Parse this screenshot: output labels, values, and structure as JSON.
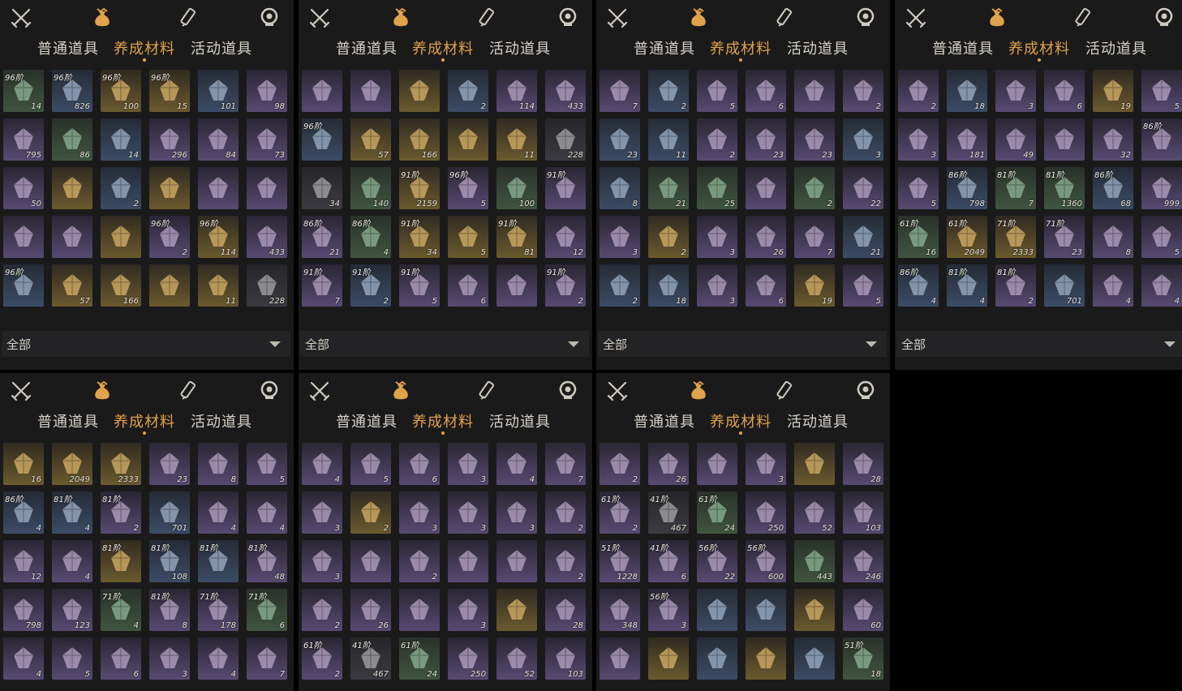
{
  "icons": [
    "crossed-swords-icon",
    "money-bag-icon",
    "scroll-icon",
    "gear-token-icon"
  ],
  "tabs": [
    "普通道具",
    "养成材料",
    "活动道具"
  ],
  "active_tab": "养成材料",
  "filter_label": "全部",
  "colors": {
    "accent": "#e0a24a",
    "tab_text": "#d6d2c9",
    "panel_bg": "#1b1a1b"
  },
  "panels": [
    {
      "id": "p1",
      "items": [
        [
          "96阶",
          "14",
          "green"
        ],
        [
          "96阶",
          "826",
          "blue"
        ],
        [
          "96阶",
          "100",
          "gold"
        ],
        [
          "96阶",
          "15",
          "gold"
        ],
        [
          "",
          "101",
          "blue"
        ],
        [
          "",
          "98",
          "purple"
        ],
        [
          "",
          "795",
          "purple"
        ],
        [
          "",
          "86",
          "green"
        ],
        [
          "",
          "14",
          "blue"
        ],
        [
          "",
          "296",
          "purple"
        ],
        [
          "",
          "84",
          "purple"
        ],
        [
          "",
          "73",
          "purple"
        ],
        [
          "",
          "50",
          "purple"
        ],
        [
          "",
          "",
          "gold"
        ],
        [
          "",
          "2",
          "blue"
        ],
        [
          "",
          "",
          "gold"
        ],
        [
          "",
          "",
          "purple"
        ],
        [
          "",
          "",
          "purple"
        ],
        [
          "",
          "",
          "purple"
        ],
        [
          "",
          "",
          "purple"
        ],
        [
          "",
          "",
          "gold"
        ],
        [
          "96阶",
          "2",
          "purple"
        ],
        [
          "96阶",
          "114",
          "gold"
        ],
        [
          "",
          "433",
          "purple"
        ],
        [
          "96阶",
          "",
          "blue"
        ],
        [
          "",
          "57",
          "gold"
        ],
        [
          "",
          "166",
          "gold"
        ],
        [
          "",
          "",
          "gold"
        ],
        [
          "",
          "11",
          "gold"
        ],
        [
          "",
          "228",
          "grey"
        ]
      ]
    },
    {
      "id": "p2",
      "items": [
        [
          "",
          "",
          "purple"
        ],
        [
          "",
          "",
          "purple"
        ],
        [
          "",
          "",
          "gold"
        ],
        [
          "",
          "2",
          "blue"
        ],
        [
          "",
          "114",
          "purple"
        ],
        [
          "",
          "433",
          "purple"
        ],
        [
          "96阶",
          "",
          "blue"
        ],
        [
          "",
          "57",
          "gold"
        ],
        [
          "",
          "166",
          "gold"
        ],
        [
          "",
          "",
          "gold"
        ],
        [
          "",
          "11",
          "gold"
        ],
        [
          "",
          "228",
          "grey"
        ],
        [
          "",
          "34",
          "grey"
        ],
        [
          "",
          "140",
          "green"
        ],
        [
          "91阶",
          "2159",
          "gold"
        ],
        [
          "96阶",
          "5",
          "purple"
        ],
        [
          "",
          "100",
          "green"
        ],
        [
          "91阶",
          "",
          "purple"
        ],
        [
          "86阶",
          "21",
          "purple"
        ],
        [
          "86阶",
          "4",
          "green"
        ],
        [
          "91阶",
          "34",
          "gold"
        ],
        [
          "",
          "5",
          "gold"
        ],
        [
          "91阶",
          "81",
          "gold"
        ],
        [
          "",
          "12",
          "purple"
        ],
        [
          "91阶",
          "7",
          "purple"
        ],
        [
          "91阶",
          "2",
          "blue"
        ],
        [
          "91阶",
          "5",
          "purple"
        ],
        [
          "",
          "6",
          "purple"
        ],
        [
          "",
          "",
          "purple"
        ],
        [
          "91阶",
          "2",
          "purple"
        ]
      ]
    },
    {
      "id": "p3",
      "items": [
        [
          "",
          "7",
          "purple"
        ],
        [
          "",
          "2",
          "blue"
        ],
        [
          "",
          "5",
          "purple"
        ],
        [
          "",
          "6",
          "purple"
        ],
        [
          "",
          "",
          "purple"
        ],
        [
          "",
          "2",
          "purple"
        ],
        [
          "",
          "23",
          "blue"
        ],
        [
          "",
          "11",
          "blue"
        ],
        [
          "",
          "2",
          "purple"
        ],
        [
          "",
          "23",
          "purple"
        ],
        [
          "",
          "23",
          "purple"
        ],
        [
          "",
          "3",
          "blue"
        ],
        [
          "",
          "8",
          "blue"
        ],
        [
          "",
          "21",
          "green"
        ],
        [
          "",
          "25",
          "green"
        ],
        [
          "",
          "",
          "purple"
        ],
        [
          "",
          "2",
          "green"
        ],
        [
          "",
          "22",
          "purple"
        ],
        [
          "",
          "3",
          "purple"
        ],
        [
          "",
          "2",
          "gold"
        ],
        [
          "",
          "3",
          "purple"
        ],
        [
          "",
          "26",
          "purple"
        ],
        [
          "",
          "7",
          "purple"
        ],
        [
          "",
          "21",
          "blue"
        ],
        [
          "",
          "2",
          "blue"
        ],
        [
          "",
          "18",
          "blue"
        ],
        [
          "",
          "3",
          "purple"
        ],
        [
          "",
          "6",
          "purple"
        ],
        [
          "",
          "19",
          "gold"
        ],
        [
          "",
          "5",
          "purple"
        ]
      ]
    },
    {
      "id": "p4",
      "items": [
        [
          "",
          "2",
          "purple"
        ],
        [
          "",
          "18",
          "blue"
        ],
        [
          "",
          "3",
          "purple"
        ],
        [
          "",
          "6",
          "purple"
        ],
        [
          "",
          "19",
          "gold"
        ],
        [
          "",
          "5",
          "purple"
        ],
        [
          "",
          "3",
          "purple"
        ],
        [
          "",
          "181",
          "purple"
        ],
        [
          "",
          "49",
          "purple"
        ],
        [
          "",
          "",
          "purple"
        ],
        [
          "",
          "32",
          "purple"
        ],
        [
          "86阶",
          "",
          "purple"
        ],
        [
          "",
          "5",
          "purple"
        ],
        [
          "86阶",
          "798",
          "blue"
        ],
        [
          "81阶",
          "7",
          "green"
        ],
        [
          "81阶",
          "1360",
          "green"
        ],
        [
          "86阶",
          "68",
          "blue"
        ],
        [
          "",
          "999",
          "purple"
        ],
        [
          "61阶",
          "16",
          "green"
        ],
        [
          "61阶",
          "2049",
          "gold"
        ],
        [
          "71阶",
          "2333",
          "gold"
        ],
        [
          "71阶",
          "23",
          "purple"
        ],
        [
          "",
          "8",
          "purple"
        ],
        [
          "",
          "5",
          "purple"
        ],
        [
          "86阶",
          "4",
          "blue"
        ],
        [
          "81阶",
          "4",
          "blue"
        ],
        [
          "81阶",
          "2",
          "purple"
        ],
        [
          "",
          "701",
          "blue"
        ],
        [
          "",
          "4",
          "purple"
        ],
        [
          "",
          "4",
          "purple"
        ]
      ]
    },
    {
      "id": "p5",
      "items": [
        [
          "",
          "16",
          "gold"
        ],
        [
          "",
          "2049",
          "gold"
        ],
        [
          "",
          "2333",
          "gold"
        ],
        [
          "",
          "23",
          "purple"
        ],
        [
          "",
          "8",
          "purple"
        ],
        [
          "",
          "5",
          "purple"
        ],
        [
          "86阶",
          "4",
          "blue"
        ],
        [
          "81阶",
          "4",
          "blue"
        ],
        [
          "81阶",
          "2",
          "purple"
        ],
        [
          "",
          "701",
          "blue"
        ],
        [
          "",
          "4",
          "purple"
        ],
        [
          "",
          "4",
          "purple"
        ],
        [
          "",
          "12",
          "purple"
        ],
        [
          "",
          "4",
          "purple"
        ],
        [
          "81阶",
          "",
          "gold"
        ],
        [
          "81阶",
          "108",
          "blue"
        ],
        [
          "81阶",
          "",
          "blue"
        ],
        [
          "81阶",
          "48",
          "purple"
        ],
        [
          "",
          "798",
          "purple"
        ],
        [
          "",
          "123",
          "purple"
        ],
        [
          "71阶",
          "4",
          "green"
        ],
        [
          "81阶",
          "8",
          "purple"
        ],
        [
          "71阶",
          "178",
          "purple"
        ],
        [
          "71阶",
          "6",
          "green"
        ],
        [
          "",
          "4",
          "purple"
        ],
        [
          "",
          "5",
          "purple"
        ],
        [
          "",
          "6",
          "purple"
        ],
        [
          "",
          "3",
          "purple"
        ],
        [
          "",
          "4",
          "purple"
        ],
        [
          "",
          "7",
          "purple"
        ]
      ]
    },
    {
      "id": "p6",
      "items": [
        [
          "",
          "4",
          "purple"
        ],
        [
          "",
          "5",
          "purple"
        ],
        [
          "",
          "6",
          "purple"
        ],
        [
          "",
          "3",
          "purple"
        ],
        [
          "",
          "4",
          "purple"
        ],
        [
          "",
          "7",
          "purple"
        ],
        [
          "",
          "3",
          "purple"
        ],
        [
          "",
          "2",
          "gold"
        ],
        [
          "",
          "3",
          "purple"
        ],
        [
          "",
          "3",
          "purple"
        ],
        [
          "",
          "3",
          "purple"
        ],
        [
          "",
          "2",
          "purple"
        ],
        [
          "",
          "3",
          "purple"
        ],
        [
          "",
          "",
          "purple"
        ],
        [
          "",
          "2",
          "purple"
        ],
        [
          "",
          "",
          "purple"
        ],
        [
          "",
          "",
          "purple"
        ],
        [
          "",
          "2",
          "purple"
        ],
        [
          "",
          "2",
          "purple"
        ],
        [
          "",
          "26",
          "purple"
        ],
        [
          "",
          "",
          "purple"
        ],
        [
          "",
          "3",
          "purple"
        ],
        [
          "",
          "",
          "gold"
        ],
        [
          "",
          "28",
          "purple"
        ],
        [
          "61阶",
          "2",
          "purple"
        ],
        [
          "41阶",
          "467",
          "grey"
        ],
        [
          "61阶",
          "24",
          "green"
        ],
        [
          "",
          "250",
          "purple"
        ],
        [
          "",
          "52",
          "purple"
        ],
        [
          "",
          "103",
          "purple"
        ]
      ]
    },
    {
      "id": "p7",
      "items": [
        [
          "",
          "2",
          "purple"
        ],
        [
          "",
          "26",
          "purple"
        ],
        [
          "",
          "",
          "purple"
        ],
        [
          "",
          "3",
          "purple"
        ],
        [
          "",
          "",
          "gold"
        ],
        [
          "",
          "28",
          "purple"
        ],
        [
          "61阶",
          "2",
          "purple"
        ],
        [
          "41阶",
          "467",
          "grey"
        ],
        [
          "61阶",
          "24",
          "green"
        ],
        [
          "",
          "250",
          "purple"
        ],
        [
          "",
          "52",
          "purple"
        ],
        [
          "",
          "103",
          "purple"
        ],
        [
          "51阶",
          "1228",
          "purple"
        ],
        [
          "41阶",
          "6",
          "purple"
        ],
        [
          "56阶",
          "22",
          "purple"
        ],
        [
          "56阶",
          "600",
          "purple"
        ],
        [
          "",
          "443",
          "green"
        ],
        [
          "",
          "246",
          "purple"
        ],
        [
          "",
          "348",
          "purple"
        ],
        [
          "56阶",
          "3",
          "purple"
        ],
        [
          "",
          "",
          "blue"
        ],
        [
          "",
          "",
          "blue"
        ],
        [
          "",
          "",
          "gold"
        ],
        [
          "",
          "60",
          "purple"
        ],
        [
          "",
          "",
          "purple"
        ],
        [
          "",
          "",
          "gold"
        ],
        [
          "",
          "",
          "blue"
        ],
        [
          "",
          "",
          "gold"
        ],
        [
          "",
          "",
          "blue"
        ],
        [
          "51阶",
          "18",
          "green"
        ]
      ]
    }
  ]
}
